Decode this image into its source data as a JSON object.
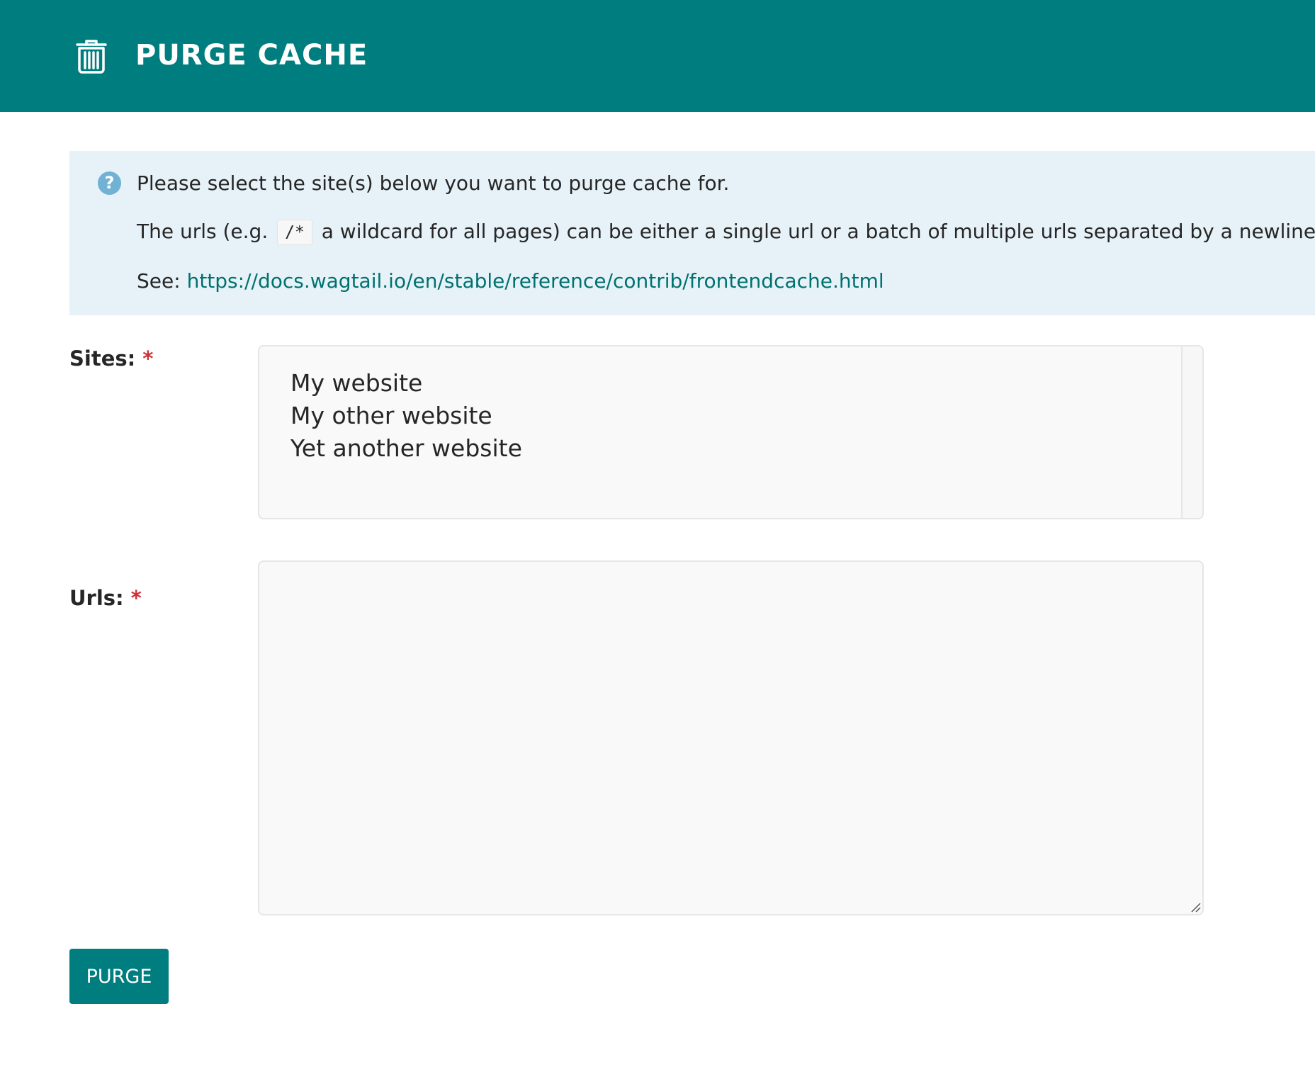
{
  "header": {
    "icon": "trash-icon",
    "title": "PURGE CACHE"
  },
  "help": {
    "icon": "question-circle-icon",
    "icon_glyph": "?",
    "line1": "Please select the site(s) below you want to purge cache for.",
    "line2_before": "The urls (e.g.",
    "line2_code": "/*",
    "line2_after": "a wildcard for all pages) can be either a single url or a batch of multiple urls separated by a newline.",
    "line3_prefix": "See:",
    "line3_link": "https://docs.wagtail.io/en/stable/reference/contrib/frontendcache.html"
  },
  "form": {
    "sites_label": "Sites:",
    "urls_label": "Urls:",
    "required_marker": "*",
    "sites_options": [
      "My website",
      "My other website",
      "Yet another website"
    ],
    "urls_value": "",
    "submit_label": "PURGE"
  },
  "colors": {
    "header_bg": "#007d7e",
    "help_bg": "#e6f2f8",
    "link": "#00716f",
    "required": "#cd3238",
    "button_bg": "#007d7e"
  }
}
